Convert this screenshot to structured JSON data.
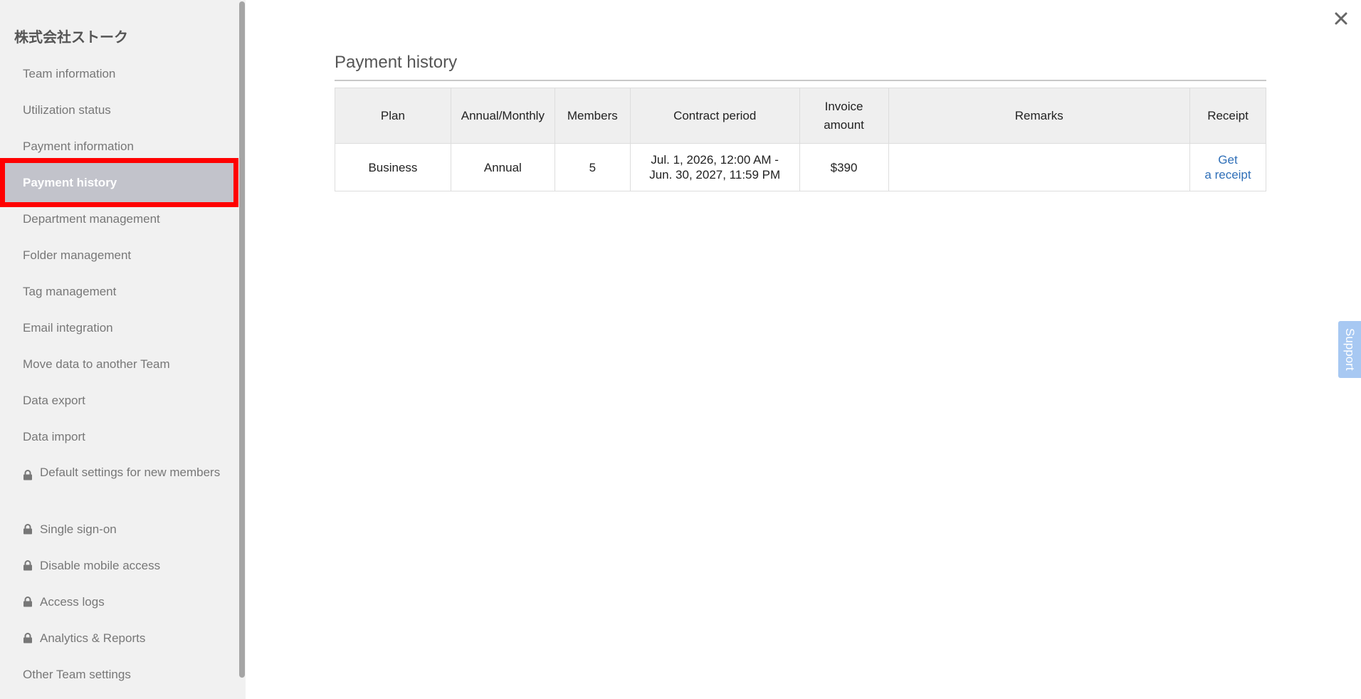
{
  "sidebar": {
    "team_name": "株式会社ストーク",
    "items": [
      {
        "label": "Team information",
        "locked": false,
        "active": false
      },
      {
        "label": "Utilization status",
        "locked": false,
        "active": false
      },
      {
        "label": "Payment information",
        "locked": false,
        "active": false
      },
      {
        "label": "Payment history",
        "locked": false,
        "active": true
      },
      {
        "label": "Department management",
        "locked": false,
        "active": false
      },
      {
        "label": "Folder management",
        "locked": false,
        "active": false
      },
      {
        "label": "Tag management",
        "locked": false,
        "active": false
      },
      {
        "label": "Email integration",
        "locked": false,
        "active": false
      },
      {
        "label": "Move data to another Team",
        "locked": false,
        "active": false
      },
      {
        "label": "Data export",
        "locked": false,
        "active": false
      },
      {
        "label": "Data import",
        "locked": false,
        "active": false
      },
      {
        "label": "Default settings for new members",
        "locked": true,
        "active": false
      },
      {
        "label": "Single sign-on",
        "locked": true,
        "active": false
      },
      {
        "label": "Disable mobile access",
        "locked": true,
        "active": false
      },
      {
        "label": "Access logs",
        "locked": true,
        "active": false
      },
      {
        "label": "Analytics & Reports",
        "locked": true,
        "active": false
      },
      {
        "label": "Other Team settings",
        "locked": false,
        "active": false
      }
    ]
  },
  "main": {
    "title": "Payment history",
    "table": {
      "headers": {
        "plan": "Plan",
        "billing": "Annual/Monthly",
        "members": "Members",
        "contract_period": "Contract period",
        "invoice_amount_line1": "Invoice",
        "invoice_amount_line2": "amount",
        "remarks": "Remarks",
        "receipt": "Receipt"
      },
      "rows": [
        {
          "plan": "Business",
          "billing": "Annual",
          "members": "5",
          "contract_period_line1": "Jul. 1, 2026, 12:00 AM -",
          "contract_period_line2": "Jun. 30, 2027, 11:59 PM",
          "invoice_amount": "$390",
          "remarks": "",
          "receipt_line1": "Get",
          "receipt_line2": "a receipt"
        }
      ]
    }
  },
  "support_tab": "Support",
  "icons": {
    "close": "close-icon",
    "lock": "lock-icon"
  },
  "colors": {
    "active_item_bg": "#c2c3cb",
    "highlight_border": "#ff0000",
    "link": "#2f6fb8",
    "support_tab": "#a7c8f2"
  }
}
